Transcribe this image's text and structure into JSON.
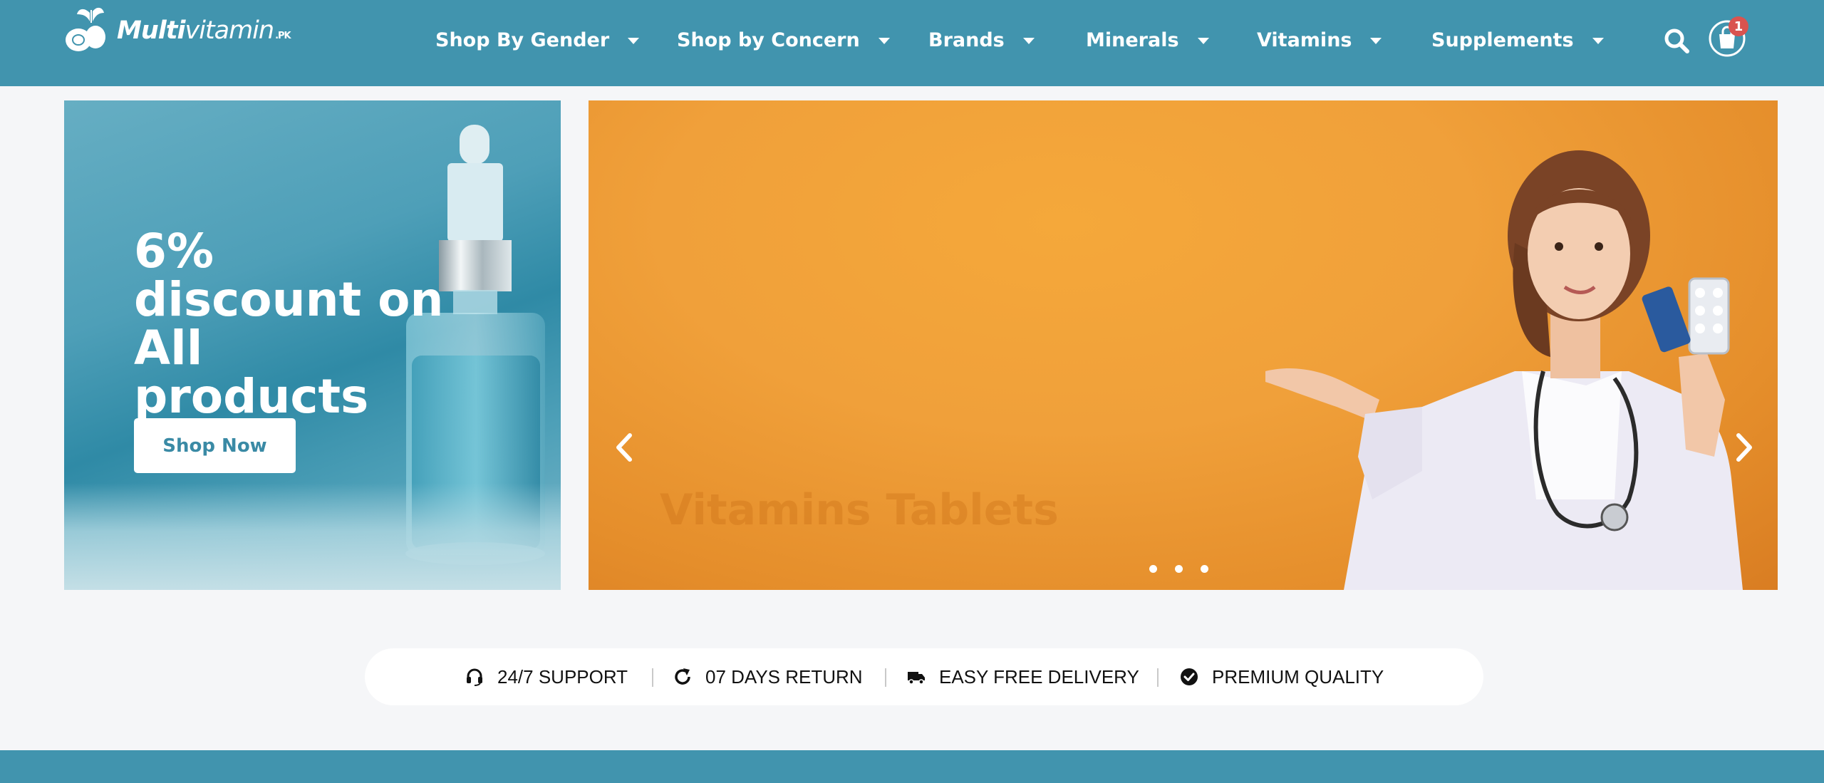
{
  "brand": {
    "name_bold": "Multi",
    "name_light": "vitamin",
    "suffix": ".PK"
  },
  "nav": {
    "items": [
      {
        "label": "Shop By Gender"
      },
      {
        "label": "Shop by Concern"
      },
      {
        "label": "Brands"
      },
      {
        "label": "Minerals"
      },
      {
        "label": "Vitamins"
      },
      {
        "label": "Supplements"
      }
    ],
    "search_icon": "search-icon",
    "cart_icon": "shopping-bag-icon",
    "cart_count": "1"
  },
  "promo": {
    "title": "6% discount on All products",
    "button": "Shop Now"
  },
  "hero": {
    "ghost_text": "Vitamins Tablets",
    "prev_icon": "chevron-left-icon",
    "next_icon": "chevron-right-icon",
    "slide_count": 3
  },
  "features": [
    {
      "icon": "headset-icon",
      "label": "24/7 SUPPORT"
    },
    {
      "icon": "rotate-icon",
      "label": "07 DAYS RETURN"
    },
    {
      "icon": "truck-icon",
      "label": "EASY FREE DELIVERY"
    },
    {
      "icon": "check-circle-icon",
      "label": "PREMIUM QUALITY"
    }
  ],
  "colors": {
    "header": "#4194ae",
    "hero_orange": "#f0a03a",
    "badge": "#d9534f",
    "page_bg": "#f5f6f8"
  }
}
